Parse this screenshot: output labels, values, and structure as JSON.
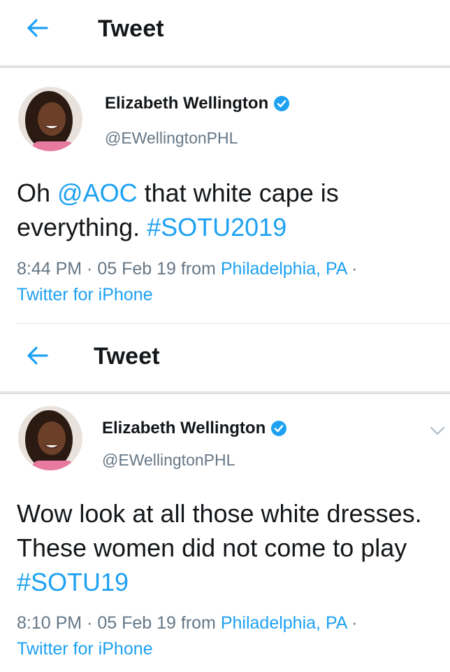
{
  "colors": {
    "accent": "#1da1f2",
    "secondary_text": "#657786",
    "primary_text": "#14171a"
  },
  "tweets": [
    {
      "header_title": "Tweet",
      "author_name": "Elizabeth Wellington",
      "author_handle": "@EWellingtonPHL",
      "text": [
        {
          "t": "Oh ",
          "type": "text"
        },
        {
          "t": "@AOC",
          "type": "mention"
        },
        {
          "t": " that white cape is everything. ",
          "type": "text"
        },
        {
          "t": "#SOTU2019",
          "type": "hashtag"
        }
      ],
      "time": "8:44 PM",
      "date": "05 Feb 19",
      "from_word": "from",
      "location": "Philadelphia, PA",
      "source": "Twitter for iPhone"
    },
    {
      "header_title": "Tweet",
      "author_name": "Elizabeth Wellington",
      "author_handle": "@EWellingtonPHL",
      "text": [
        {
          "t": "Wow look at all those white dresses. These women did not come to play ",
          "type": "text"
        },
        {
          "t": "#SOTU19",
          "type": "hashtag"
        }
      ],
      "time": "8:10 PM",
      "date": "05 Feb 19",
      "from_word": "from",
      "location": "Philadelphia, PA",
      "source": "Twitter for iPhone"
    }
  ],
  "icons": {
    "back": "arrow-left-icon",
    "verified": "verified-badge-icon",
    "more": "chevron-down-icon"
  }
}
